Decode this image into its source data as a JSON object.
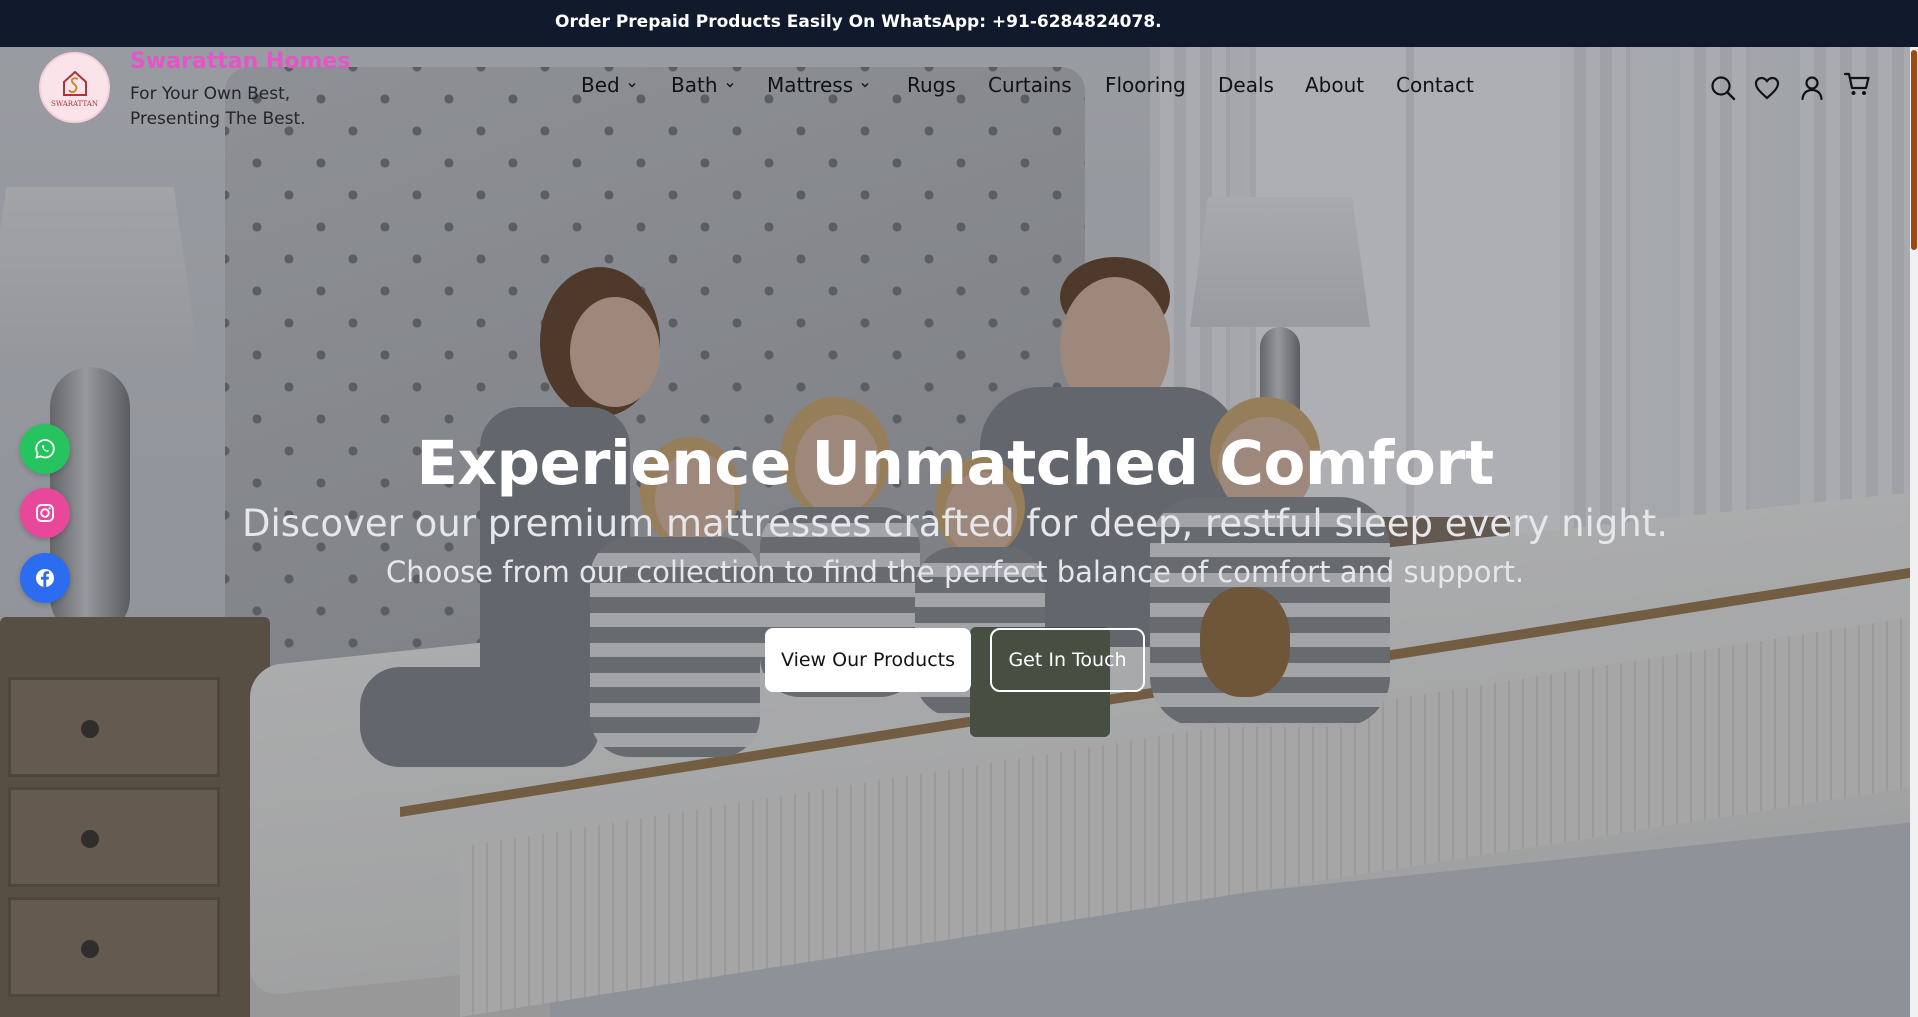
{
  "announcement": {
    "text": "Order Prepaid Products Easily On WhatsApp: +91-6284824078."
  },
  "brand": {
    "name": "Swarattan Homes",
    "tagline": "For Your Own Best, Presenting The Best.",
    "logo_text": "SWARATTAN",
    "logo_icon": "house-monogram-icon",
    "name_color": "#e455c8"
  },
  "nav": {
    "items": [
      {
        "label": "Bed",
        "has_dropdown": true
      },
      {
        "label": "Bath",
        "has_dropdown": true
      },
      {
        "label": "Mattress",
        "has_dropdown": true
      },
      {
        "label": "Rugs",
        "has_dropdown": false
      },
      {
        "label": "Curtains",
        "has_dropdown": false
      },
      {
        "label": "Flooring",
        "has_dropdown": false
      },
      {
        "label": "Deals",
        "has_dropdown": false
      },
      {
        "label": "About",
        "has_dropdown": false
      },
      {
        "label": "Contact",
        "has_dropdown": false
      }
    ]
  },
  "header_icons": [
    "search-icon",
    "heart-icon",
    "user-icon",
    "cart-icon"
  ],
  "social": [
    {
      "name": "whatsapp-icon",
      "color": "#25c45e"
    },
    {
      "name": "instagram-icon",
      "color": "#e8479a"
    },
    {
      "name": "facebook-icon",
      "color": "#2b6cf0"
    }
  ],
  "hero": {
    "title": "Experience Unmatched Comfort",
    "subtitle": "Discover our premium mattresses crafted for deep, restful sleep every night.",
    "subtitle2": "Choose from our collection to find the perfect balance of comfort and support.",
    "primary_button": "View Our Products",
    "secondary_button": "Get In Touch"
  },
  "colors": {
    "announcement_bg": "#111a2c",
    "scrollbar_thumb": "#9b4a12"
  }
}
